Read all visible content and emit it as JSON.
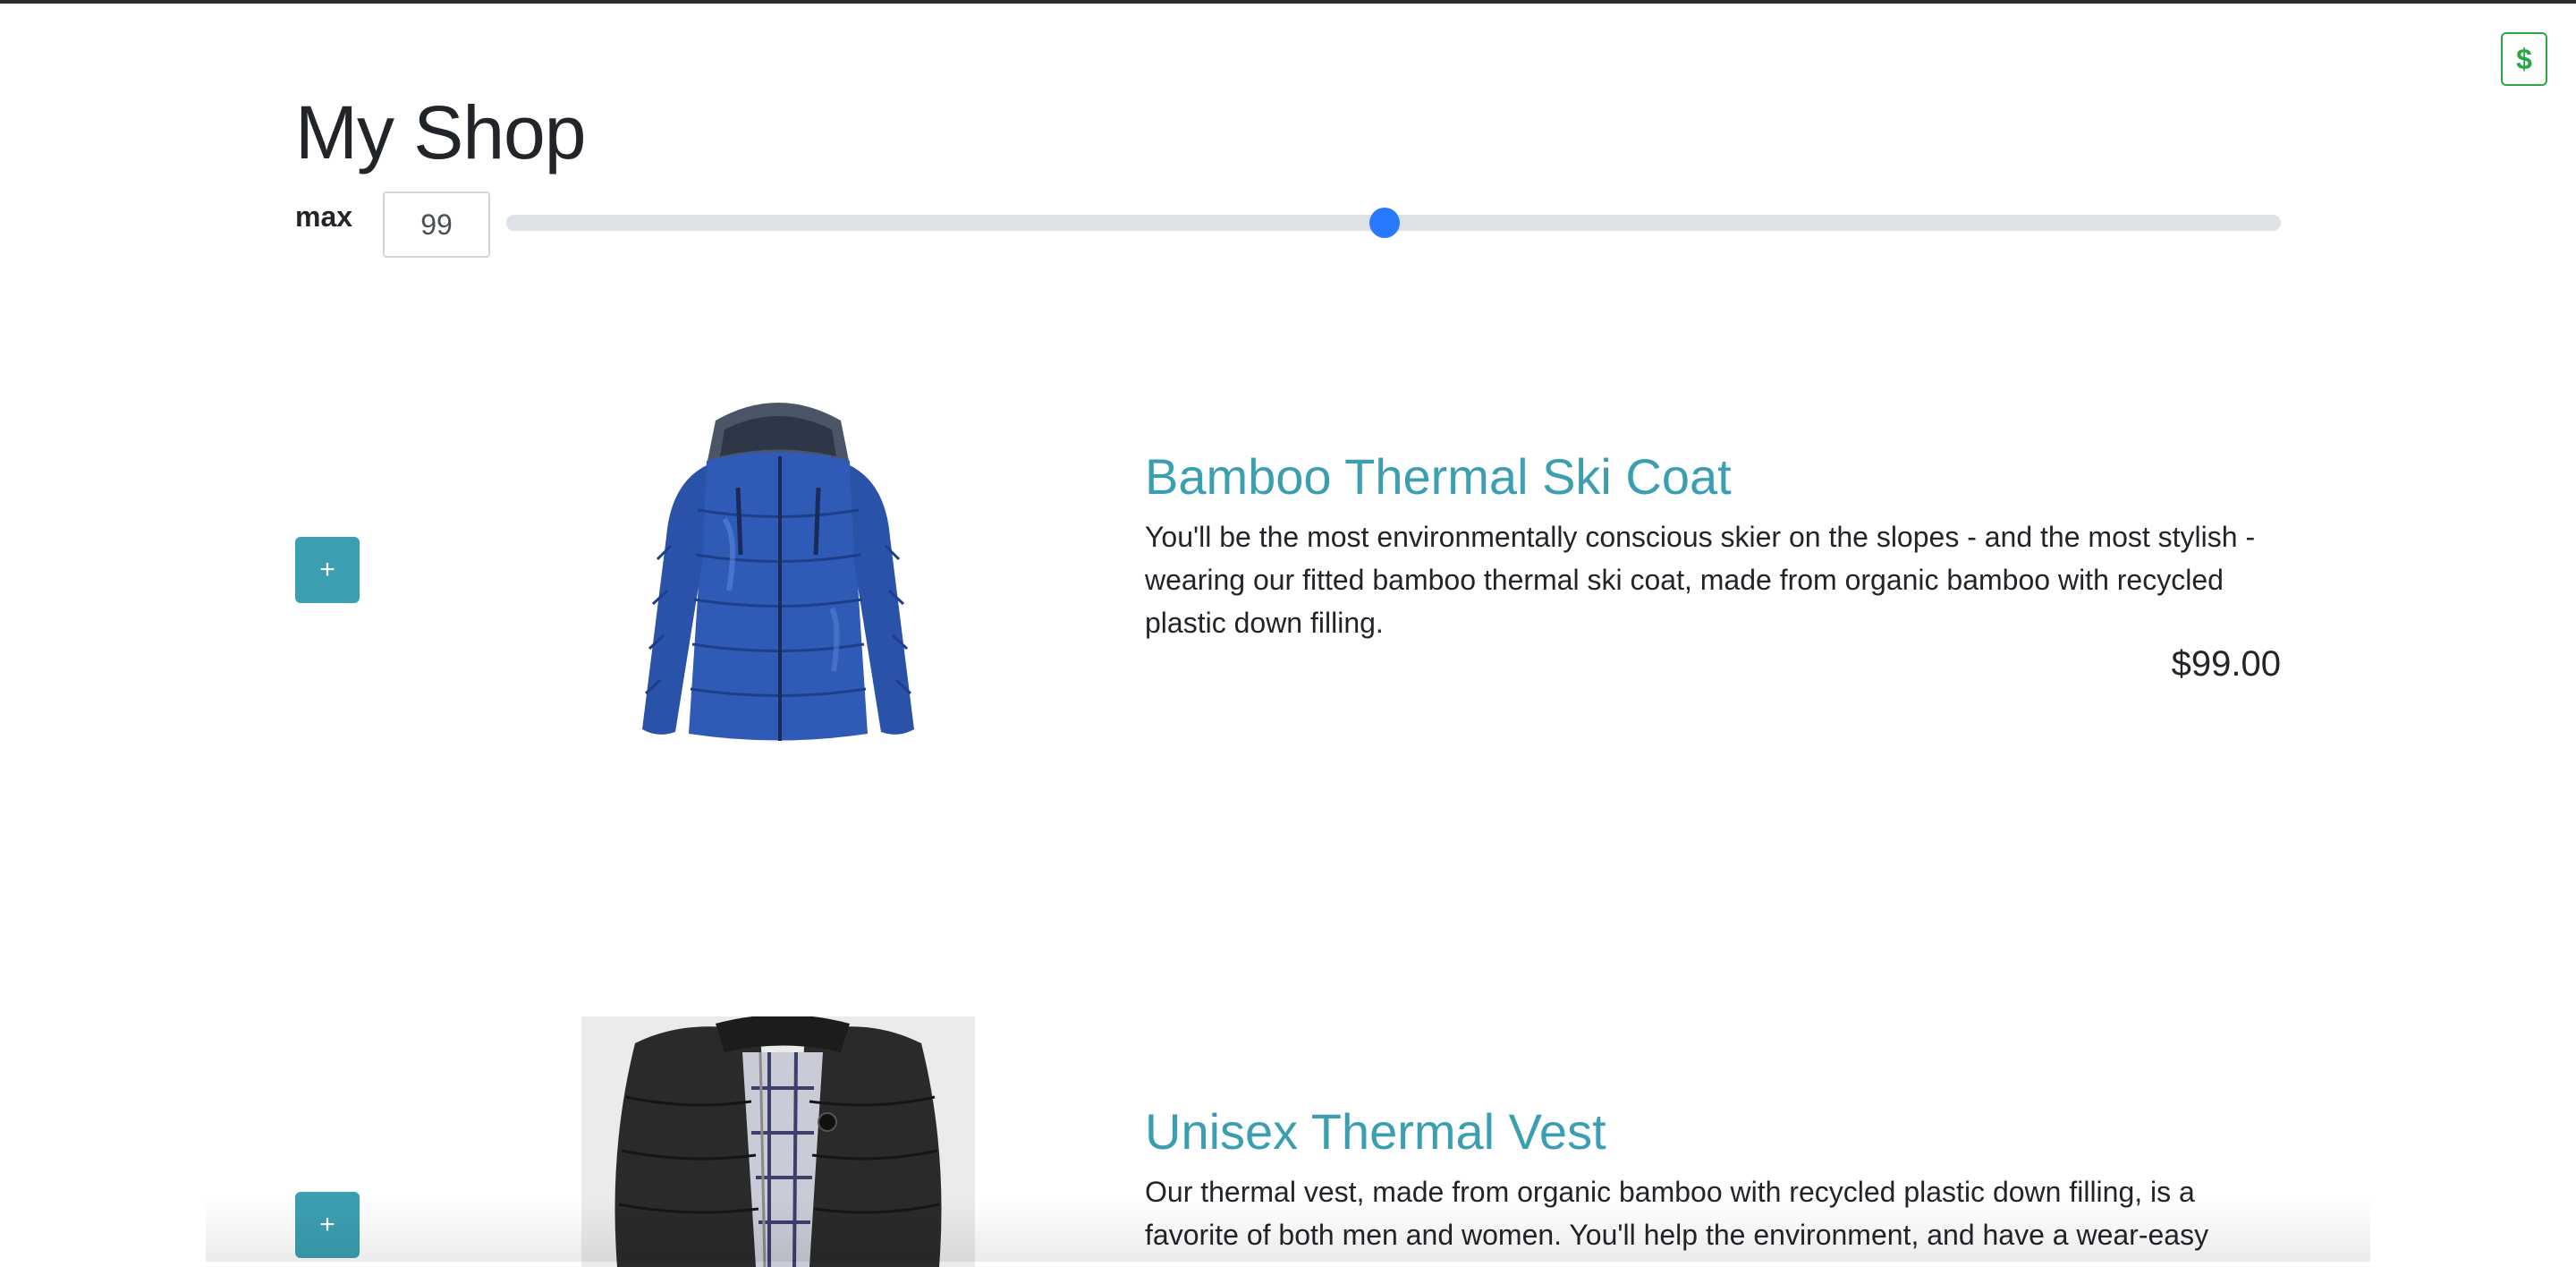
{
  "header": {
    "title": "My Shop",
    "cart_icon": "dollar-icon",
    "cart_symbol": "$"
  },
  "filter": {
    "label": "max",
    "value": "99",
    "slider_fraction": 0.495
  },
  "products": [
    {
      "add_label": "+",
      "name": "Bamboo Thermal Ski Coat",
      "description": "You'll be the most environmentally conscious skier on the slopes - and the most stylish - wearing our fitted bamboo thermal ski coat, made from organic bamboo with recycled plastic down filling.",
      "price": "$99.00",
      "image": "blue-ski-coat"
    },
    {
      "add_label": "+",
      "name": "Unisex Thermal Vest",
      "description": "Our thermal vest, made from organic bamboo with recycled plastic down filling, is a favorite of both men and women. You'll help the environment, and have a wear-easy",
      "image": "black-thermal-vest"
    }
  ],
  "colors": {
    "accent": "#3b9fb1",
    "cart_green": "#28a745",
    "slider_thumb": "#2979ff"
  }
}
